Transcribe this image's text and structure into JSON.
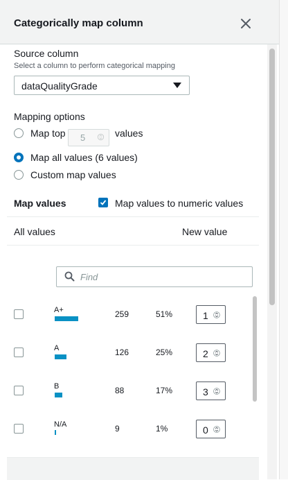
{
  "header": {
    "title": "Categorically map column"
  },
  "source": {
    "label": "Source column",
    "description": "Select a column to perform categorical mapping",
    "selected": "dataQualityGrade"
  },
  "mapping_options": {
    "label": "Mapping options",
    "map_top_label": "Map top",
    "map_top_value": "5",
    "map_top_suffix": "values",
    "map_all_label": "Map all values (6 values)",
    "custom_label": "Custom map values",
    "selected": "map_all"
  },
  "map_values": {
    "heading": "Map values",
    "numeric_checkbox_label": "Map values to numeric values",
    "numeric_checked": true
  },
  "columns": {
    "all_values": "All values",
    "new_value": "New value"
  },
  "search": {
    "placeholder": "Find"
  },
  "rows": [
    {
      "category": "A+",
      "count": "259",
      "percent": "51%",
      "share": 0.51,
      "new_value": "1",
      "checked": false
    },
    {
      "category": "A",
      "count": "126",
      "percent": "25%",
      "share": 0.25,
      "new_value": "2",
      "checked": false
    },
    {
      "category": "B",
      "count": "88",
      "percent": "17%",
      "share": 0.17,
      "new_value": "3",
      "checked": false
    },
    {
      "category": "N/A",
      "count": "9",
      "percent": "1%",
      "share": 0.01,
      "new_value": "0",
      "checked": false
    }
  ],
  "colors": {
    "accent": "#0073bb",
    "bar": "#0a91c4"
  }
}
